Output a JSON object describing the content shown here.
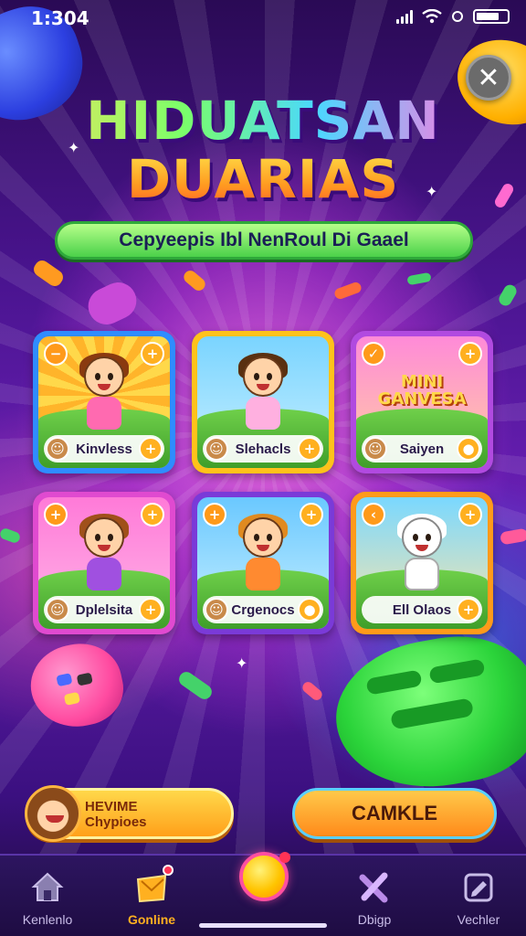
{
  "status_bar": {
    "time": "1:304",
    "icons": [
      "signal-icon",
      "wifi-icon",
      "gear-icon",
      "battery-icon"
    ]
  },
  "header": {
    "close_label": "✕",
    "title_line_1": "HIDUATSAN",
    "title_line_2": "DUARIAS",
    "subtitle": "Cepyeepis Ibl NenRoul Di Gaael"
  },
  "games": [
    {
      "label": "Kinvless",
      "theme": "sunburst",
      "art_text": "",
      "badge_tl": "−",
      "badge_tr": "+",
      "badge_bl": "☺",
      "badge_br": "+"
    },
    {
      "label": "Slehacls",
      "theme": "meadow",
      "art_text": "",
      "badge_tl": "",
      "badge_tr": "",
      "badge_bl": "☺",
      "badge_br": "+"
    },
    {
      "label": "Saiyen",
      "theme": "park",
      "art_text": "MINI GANVESA",
      "badge_tl": "✓",
      "badge_tr": "+",
      "badge_bl": "☺",
      "badge_br": "●"
    },
    {
      "label": "Dplelsita",
      "theme": "party",
      "art_text": "",
      "badge_tl": "+",
      "badge_tr": "+",
      "badge_bl": "☺",
      "badge_br": "+"
    },
    {
      "label": "Crgenocs",
      "theme": "tropics",
      "art_text": "",
      "badge_tl": "+",
      "badge_tr": "+",
      "badge_bl": "☺",
      "badge_br": "●"
    },
    {
      "label": "Ell Olaos",
      "theme": "beach",
      "art_text": "",
      "badge_tl": "‹",
      "badge_tr": "+",
      "badge_bl": "",
      "badge_br": "+"
    }
  ],
  "actions": {
    "profile_line_1": "HEVIME",
    "profile_line_2": "Chypioes",
    "main_button": "CAMKLE"
  },
  "nav": {
    "items": [
      {
        "label": "Kenlenlo",
        "icon": "house-icon",
        "active": false
      },
      {
        "label": "Gonline",
        "icon": "gift-icon",
        "active": true
      },
      {
        "label": "Dbigp",
        "icon": "wrench-icon",
        "active": false
      },
      {
        "label": "Vechler",
        "icon": "edit-icon",
        "active": false
      }
    ],
    "center_icon": "play-orb-icon"
  },
  "colors": {
    "accent_yellow": "#ffb020",
    "banner_green": "#4bd14a",
    "nav_background": "#1e0c42"
  }
}
